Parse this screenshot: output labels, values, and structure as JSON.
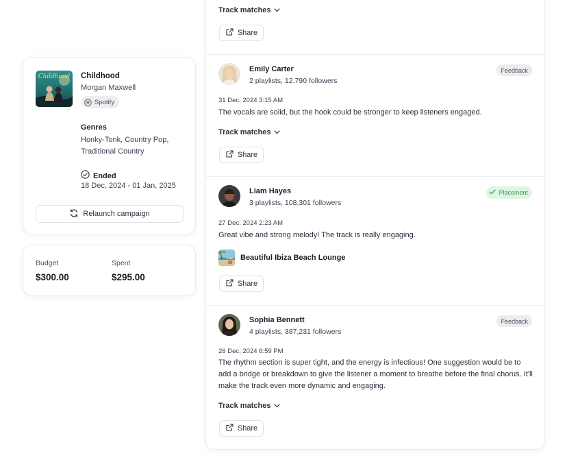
{
  "campaign": {
    "track_title": "Childhood",
    "cover_text": "Childhood",
    "artist": "Morgan Maxwell",
    "platform": "Spotify",
    "genres_heading": "Genres",
    "genres": "Honky-Tonk, Country Pop, Traditional Country",
    "status": "Ended",
    "date_range": "18 Dec, 2024 - 01 Jan, 2025",
    "relaunch_label": "Relaunch campaign"
  },
  "budget": {
    "budget_label": "Budget",
    "budget_value": "$300.00",
    "spent_label": "Spent",
    "spent_value": "$295.00"
  },
  "feed": {
    "track_matches_label": "Track matches",
    "share_label": "Share",
    "reviews": [
      {
        "curator": "Emily Carter",
        "stats": "2 playlists, 12,790 followers",
        "badge": "Feedback",
        "timestamp": "31 Dec, 2024 3:15 AM",
        "comment": "The vocals are solid, but the hook could be stronger to keep listeners engaged."
      },
      {
        "curator": "Liam Hayes",
        "stats": "3 playlists, 108,301 followers",
        "badge": "Placement",
        "timestamp": "27 Dec, 2024 2:23 AM",
        "comment": "Great vibe and strong melody! The track is really engaging.",
        "playlist": "Beautiful Ibiza Beach Lounge"
      },
      {
        "curator": "Sophia Bennett",
        "stats": "4 playlists, 387,231 followers",
        "badge": "Feedback",
        "timestamp": "26 Dec, 2024 6:59 PM",
        "comment": "The rhythm section is super tight, and the energy is infectious! One suggestion would be to add a bridge or breakdown to give the listener a moment to breathe before the final chorus. It'll make the track even more dynamic and engaging."
      }
    ]
  },
  "colors": {
    "placement_bg": "#ddf6e3",
    "placement_text": "#3e9b57",
    "feedback_bg": "#ececef"
  }
}
